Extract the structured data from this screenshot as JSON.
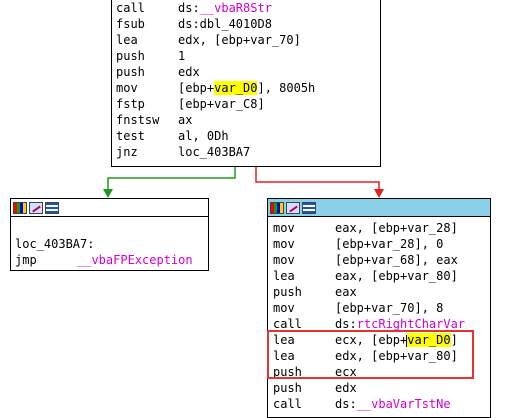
{
  "top_block": {
    "lines": [
      {
        "mnemonic": "call",
        "operand_prefix": "ds:",
        "operand_fn": "__vbaR8Str"
      },
      {
        "mnemonic": "fsub",
        "operand": "ds:dbl_4010D8"
      },
      {
        "mnemonic": "lea",
        "operand": "edx, [ebp+var_70]"
      },
      {
        "mnemonic": "push",
        "operand": "1"
      },
      {
        "mnemonic": "push",
        "operand": "edx"
      },
      {
        "mnemonic": "mov",
        "operand_prefix": "[ebp+",
        "operand_hl": "var_D0",
        "operand_suffix": "], 8005h"
      },
      {
        "mnemonic": "fstp",
        "operand": "[ebp+var_C8]"
      },
      {
        "mnemonic": "fnstsw",
        "operand": "ax"
      },
      {
        "mnemonic": "test",
        "operand": "al, 0Dh"
      },
      {
        "mnemonic": "jnz",
        "operand": "loc_403BA7"
      }
    ]
  },
  "left_block": {
    "label": "loc_403BA7:",
    "mnemonic": "jmp",
    "operand": "__vbaFPException"
  },
  "right_block": {
    "lines": [
      {
        "mnemonic": "mov",
        "operand": "eax, [ebp+var_28]"
      },
      {
        "mnemonic": "mov",
        "operand": "[ebp+var_28], 0"
      },
      {
        "mnemonic": "mov",
        "operand": "[ebp+var_68], eax"
      },
      {
        "mnemonic": "lea",
        "operand": "eax, [ebp+var_80]"
      },
      {
        "mnemonic": "push",
        "operand": "eax"
      },
      {
        "mnemonic": "mov",
        "operand": "[ebp+var_70], 8"
      },
      {
        "mnemonic": "call",
        "operand_prefix": "ds:",
        "operand_fn": "rtcRightCharVar"
      },
      {
        "mnemonic": "lea",
        "operand_prefix": "ecx, [ebp+",
        "operand_hl": "var_D0",
        "operand_suffix": "]"
      },
      {
        "mnemonic": "lea",
        "operand": "edx, [ebp+var_80]"
      },
      {
        "mnemonic": "push",
        "operand": "ecx"
      },
      {
        "mnemonic": "push",
        "operand": "edx"
      },
      {
        "mnemonic": "call",
        "operand_prefix": "ds:",
        "operand_fn": "__vbaVarTstNe"
      }
    ]
  },
  "colors": {
    "edge_true": "#1f9a1f",
    "edge_false": "#e52020",
    "highlight": "#ffff00",
    "selection_box": "#e53333",
    "header_blue": "#8ad0e8"
  }
}
